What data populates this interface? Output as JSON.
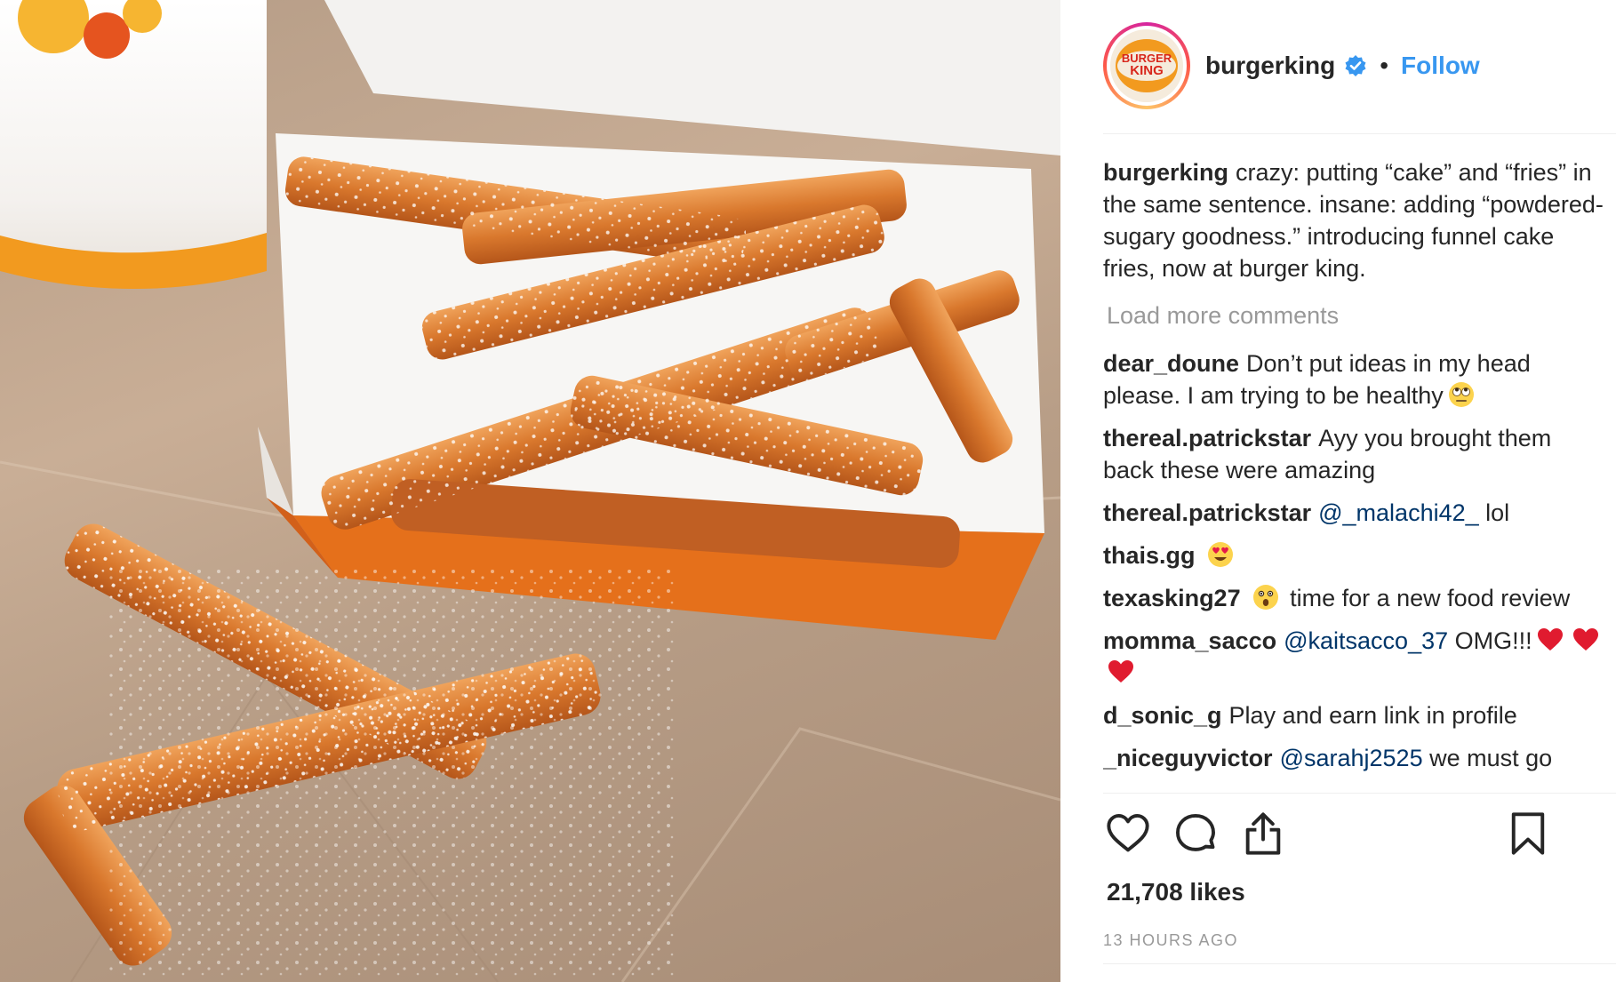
{
  "post": {
    "username": "burgerking",
    "separator": "•",
    "follow_label": "Follow",
    "avatar_text": [
      "BURGER",
      "KING"
    ],
    "caption": {
      "user": "burgerking",
      "text": "crazy: putting “cake” and “fries” in the same sentence. insane: adding “powdered-sugary goodness.” introducing funnel cake fries, now at burger king."
    },
    "load_more_label": "Load more comments",
    "comments": [
      {
        "user": "dear_doune",
        "parts": [
          {
            "t": "text",
            "v": "Don’t put ideas in my head please. I am trying to be healthy"
          },
          {
            "t": "emoji",
            "v": "rolling-eyes"
          }
        ]
      },
      {
        "user": "thereal.patrickstar",
        "parts": [
          {
            "t": "text",
            "v": "Ayy you brought them back these were amazing"
          }
        ]
      },
      {
        "user": "thereal.patrickstar",
        "parts": [
          {
            "t": "mention",
            "v": "@_malachi42_"
          },
          {
            "t": "text",
            "v": " lol"
          }
        ]
      },
      {
        "user": "thais.gg",
        "parts": [
          {
            "t": "emoji",
            "v": "heart-eyes"
          }
        ]
      },
      {
        "user": "texasking27",
        "parts": [
          {
            "t": "emoji",
            "v": "astonished"
          },
          {
            "t": "text",
            "v": " time for a new food review"
          }
        ]
      },
      {
        "user": "momma_sacco",
        "parts": [
          {
            "t": "mention",
            "v": "@kaitsacco_37"
          },
          {
            "t": "text",
            "v": " OMG!!!"
          },
          {
            "t": "emoji",
            "v": "red-heart"
          },
          {
            "t": "emoji",
            "v": "red-heart"
          },
          {
            "t": "emoji",
            "v": "red-heart"
          }
        ]
      },
      {
        "user": "d_sonic_g",
        "parts": [
          {
            "t": "text",
            "v": "Play and earn link in profile"
          }
        ]
      },
      {
        "user": "_niceguyvictor",
        "parts": [
          {
            "t": "mention",
            "v": "@sarahj2525"
          },
          {
            "t": "text",
            "v": " we must go"
          }
        ]
      }
    ],
    "likes": "21,708 likes",
    "time": "13 HOURS AGO",
    "colors": {
      "text": "#262626",
      "secondary": "#999999",
      "link": "#3897f0",
      "mention": "#003569",
      "verified": "#3897f0",
      "divider": "#efefef"
    },
    "icons": {
      "like": "heart-icon",
      "comment": "comment-bubble-icon",
      "share": "share-upload-icon",
      "save": "bookmark-icon",
      "verified": "verified-badge-icon"
    }
  }
}
